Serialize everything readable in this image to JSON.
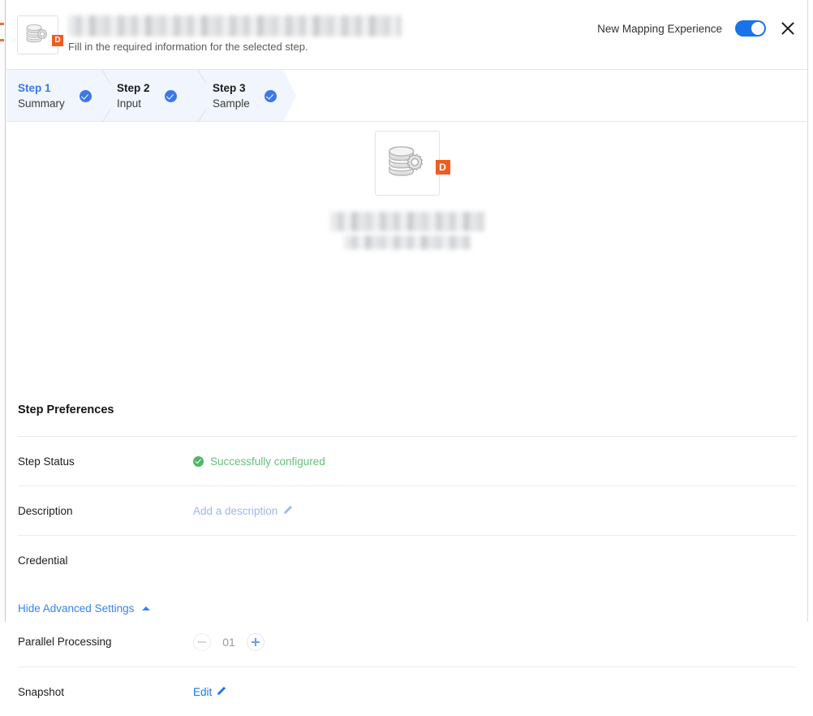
{
  "header": {
    "icon_name": "database-gear-icon",
    "badge": "D",
    "title_redacted": "",
    "subtitle": "Fill in the required information for the selected step.",
    "toggle_label": "New Mapping Experience",
    "toggle_on": true,
    "close_label": "×"
  },
  "stepper": {
    "steps": [
      {
        "title": "Step 1",
        "sub": "Summary",
        "state": "active",
        "complete": true
      },
      {
        "title": "Step 2",
        "sub": "Input",
        "state": "done",
        "complete": true
      },
      {
        "title": "Step 3",
        "sub": "Sample",
        "state": "done",
        "complete": true
      }
    ]
  },
  "hero": {
    "icon_name": "database-gear-icon",
    "badge": "D",
    "title_redacted": "",
    "subtitle_redacted": ""
  },
  "preferences": {
    "section_title": "Step Preferences",
    "rows": [
      {
        "label": "Step Status",
        "value": "Successfully configured",
        "kind": "status-ok"
      },
      {
        "label": "Description",
        "value": "Add a description",
        "kind": "link-muted"
      },
      {
        "label": "Credential",
        "value": "",
        "kind": "redacted"
      }
    ],
    "advanced_toggle": "Hide Advanced Settings",
    "advanced_rows": [
      {
        "label": "Parallel Processing",
        "value": "01",
        "kind": "stepper"
      },
      {
        "label": "Snapshot",
        "value": "Edit",
        "kind": "link-blue"
      }
    ]
  },
  "colors": {
    "accent_blue": "#1a73e8",
    "step_blue": "#3b78e7",
    "badge_orange": "#ee5d21",
    "success_green": "#64c17a",
    "step_bg": "#f1f5fd"
  }
}
